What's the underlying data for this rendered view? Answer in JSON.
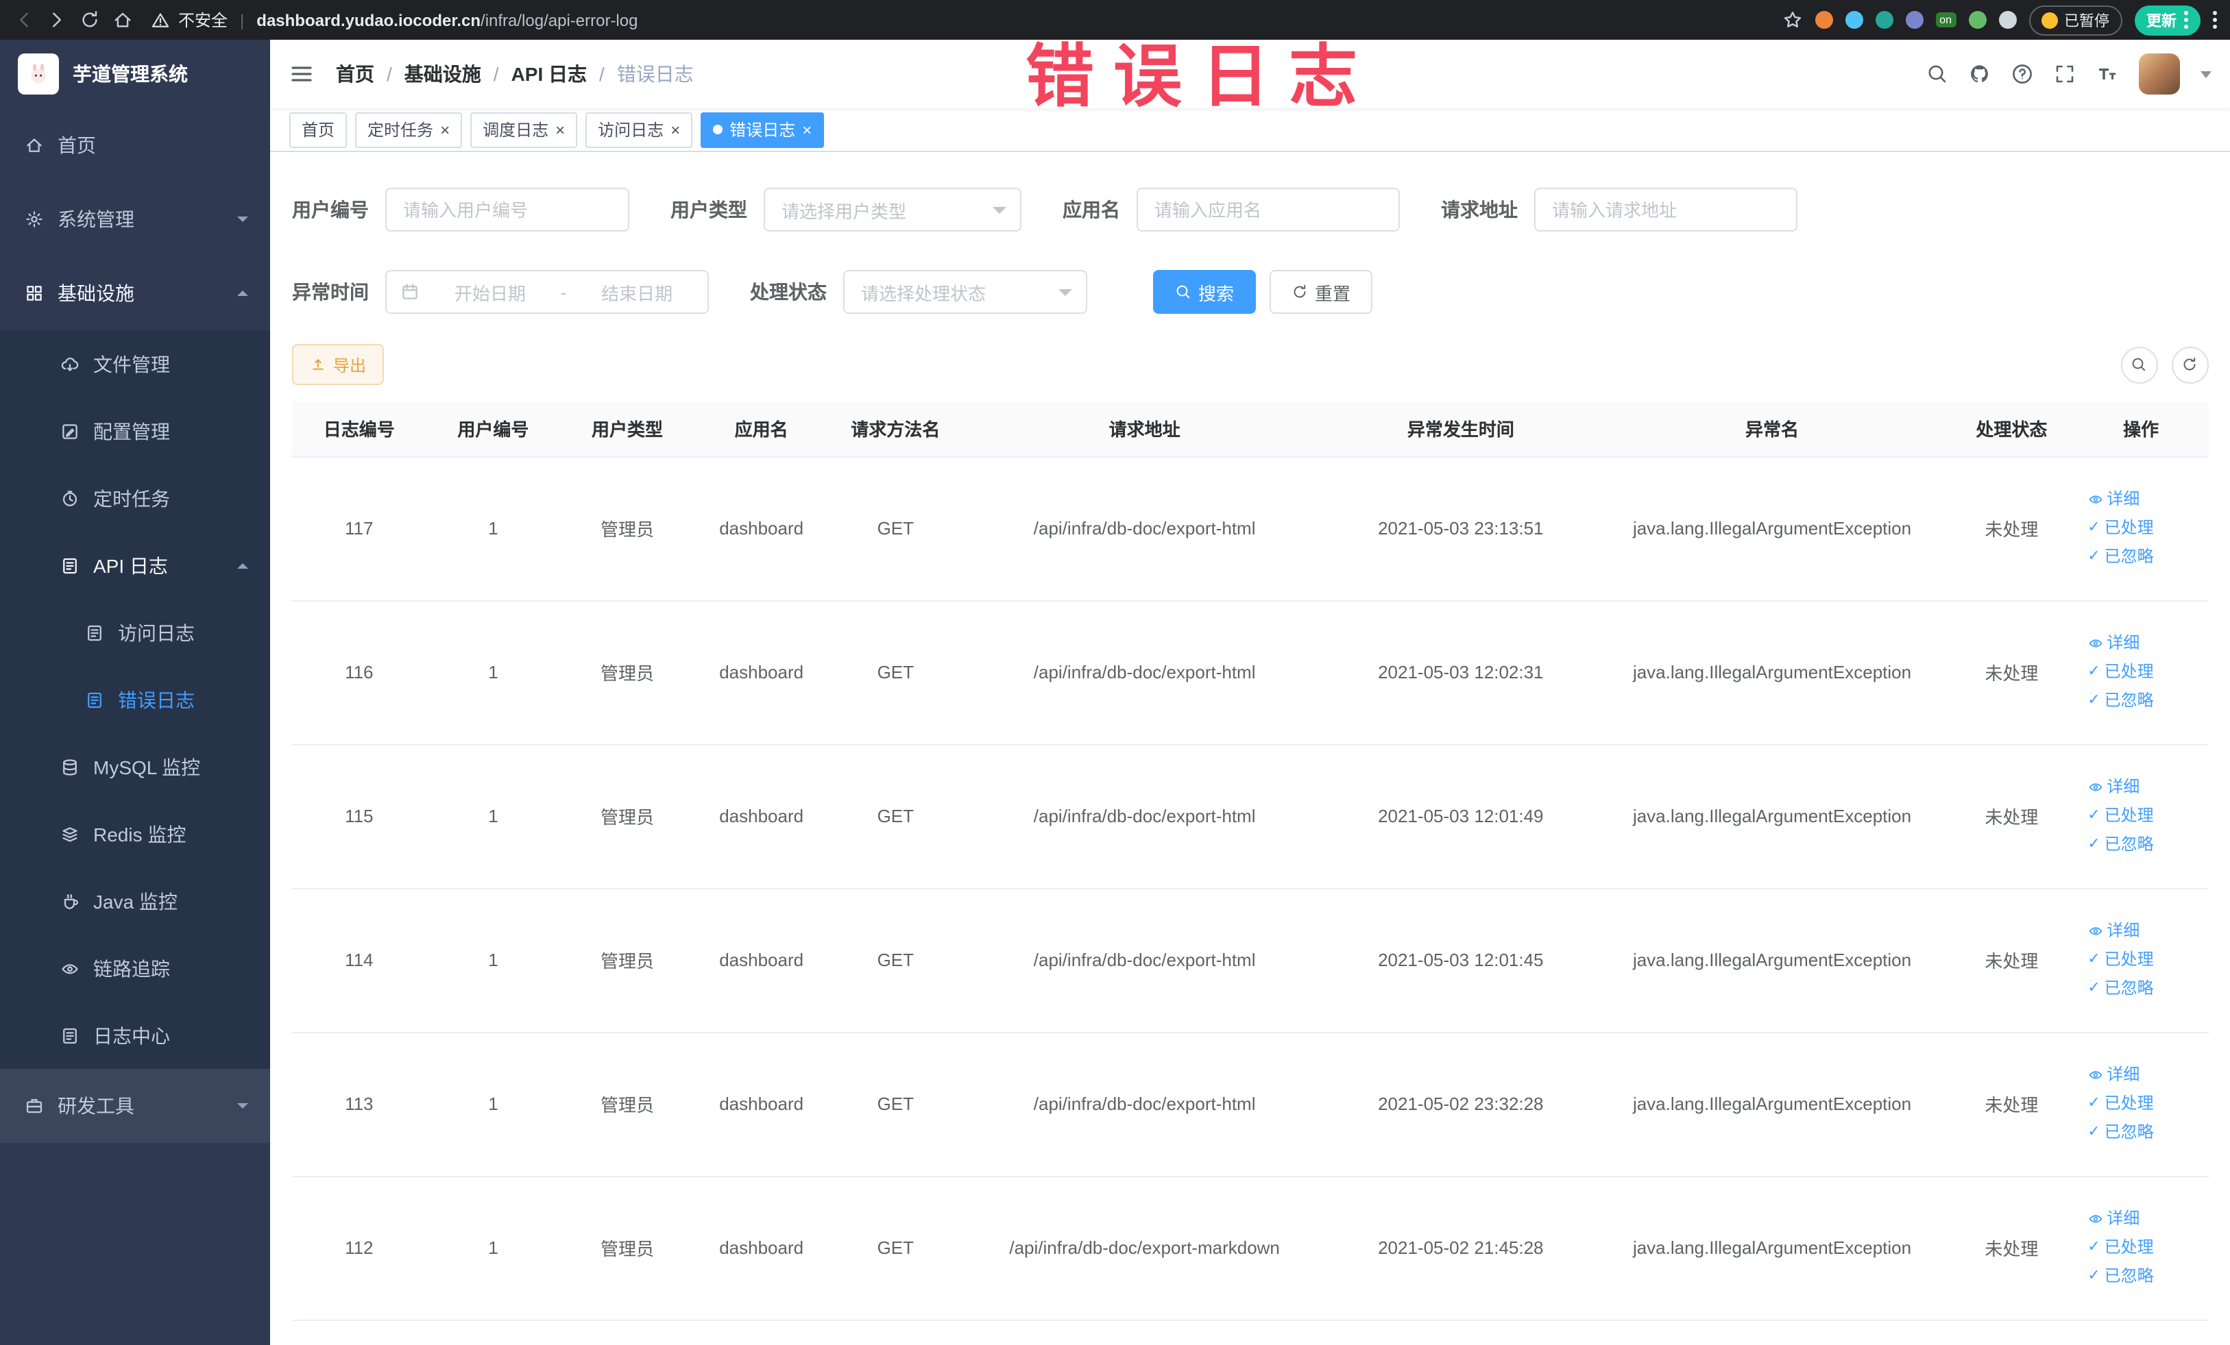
{
  "browser": {
    "security_label": "不安全",
    "url_domain": "dashboard.yudao.iocoder.cn",
    "url_path": "/infra/log/api-error-log",
    "extension_badge_on": "on",
    "paused_badge": "已暂停",
    "update_button": "更新"
  },
  "annotation": {
    "text": "错误日志",
    "color": "#f2455d"
  },
  "colors": {
    "primary": "#409eff",
    "warning_text": "#e6a23c",
    "sidebar_bg": "#2f3a52",
    "tag_active_bg": "#409eff",
    "update_button_bg": "#17c7a0"
  },
  "icons": {
    "close": "×",
    "check": "✓"
  },
  "sidebar": {
    "logo_title": "芋道管理系统",
    "items": [
      {
        "label": "首页"
      },
      {
        "label": "系统管理"
      },
      {
        "label": "基础设施"
      },
      {
        "label": "文件管理"
      },
      {
        "label": "配置管理"
      },
      {
        "label": "定时任务"
      },
      {
        "label": "API 日志"
      },
      {
        "label": "访问日志"
      },
      {
        "label": "错误日志"
      },
      {
        "label": "MySQL 监控"
      },
      {
        "label": "Redis 监控"
      },
      {
        "label": "Java 监控"
      },
      {
        "label": "链路追踪"
      },
      {
        "label": "日志中心"
      },
      {
        "label": "研发工具"
      }
    ]
  },
  "breadcrumb": {
    "separator": "/",
    "items": [
      "首页",
      "基础设施",
      "API 日志",
      "错误日志"
    ]
  },
  "tabs": [
    {
      "label": "首页"
    },
    {
      "label": "定时任务"
    },
    {
      "label": "调度日志"
    },
    {
      "label": "访问日志"
    },
    {
      "label": "错误日志"
    }
  ],
  "filters": {
    "user_id_label": "用户编号",
    "user_id_placeholder": "请输入用户编号",
    "user_type_label": "用户类型",
    "user_type_placeholder": "请选择用户类型",
    "app_name_label": "应用名",
    "app_name_placeholder": "请输入应用名",
    "request_url_label": "请求地址",
    "request_url_placeholder": "请输入请求地址",
    "exception_time_label": "异常时间",
    "date_start_placeholder": "开始日期",
    "date_separator": "-",
    "date_end_placeholder": "结束日期",
    "process_status_label": "处理状态",
    "process_status_placeholder": "请选择处理状态",
    "search_button": "搜索",
    "reset_button": "重置"
  },
  "toolbar": {
    "export_button": "导出"
  },
  "table": {
    "columns": [
      "日志编号",
      "用户编号",
      "用户类型",
      "应用名",
      "请求方法名",
      "请求地址",
      "异常发生时间",
      "异常名",
      "处理状态",
      "操作"
    ],
    "actions": {
      "detail": "详细",
      "processed": "已处理",
      "ignored": "已忽略"
    },
    "rows": [
      {
        "id": "117",
        "user_id": "1",
        "user_type": "管理员",
        "app": "dashboard",
        "method": "GET",
        "url": "/api/infra/db-doc/export-html",
        "time": "2021-05-03 23:13:51",
        "exception": "java.lang.IllegalArgumentException",
        "status": "未处理"
      },
      {
        "id": "116",
        "user_id": "1",
        "user_type": "管理员",
        "app": "dashboard",
        "method": "GET",
        "url": "/api/infra/db-doc/export-html",
        "time": "2021-05-03 12:02:31",
        "exception": "java.lang.IllegalArgumentException",
        "status": "未处理"
      },
      {
        "id": "115",
        "user_id": "1",
        "user_type": "管理员",
        "app": "dashboard",
        "method": "GET",
        "url": "/api/infra/db-doc/export-html",
        "time": "2021-05-03 12:01:49",
        "exception": "java.lang.IllegalArgumentException",
        "status": "未处理"
      },
      {
        "id": "114",
        "user_id": "1",
        "user_type": "管理员",
        "app": "dashboard",
        "method": "GET",
        "url": "/api/infra/db-doc/export-html",
        "time": "2021-05-03 12:01:45",
        "exception": "java.lang.IllegalArgumentException",
        "status": "未处理"
      },
      {
        "id": "113",
        "user_id": "1",
        "user_type": "管理员",
        "app": "dashboard",
        "method": "GET",
        "url": "/api/infra/db-doc/export-html",
        "time": "2021-05-02 23:32:28",
        "exception": "java.lang.IllegalArgumentException",
        "status": "未处理"
      },
      {
        "id": "112",
        "user_id": "1",
        "user_type": "管理员",
        "app": "dashboard",
        "method": "GET",
        "url": "/api/infra/db-doc/export-markdown",
        "time": "2021-05-02 21:45:28",
        "exception": "java.lang.IllegalArgumentException",
        "status": "未处理"
      }
    ]
  }
}
